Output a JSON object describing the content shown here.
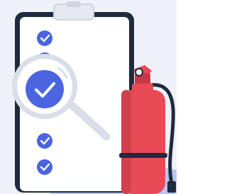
{
  "illustration": {
    "checklist_items": [
      {
        "checked": true
      },
      {
        "checked": true
      },
      {
        "checked": true
      },
      {
        "checked": true
      }
    ],
    "colors": {
      "background_tint": "#eef2f8",
      "clipboard_frame": "#1f2a3c",
      "clipboard_paper": "#ffffff",
      "check_blue": "#4b64e0",
      "magnifier_ring": "#d9dee8",
      "magnifier_lens": "#ffffff",
      "extinguisher_red": "#e84a56",
      "extinguisher_shadow": "#c8374a",
      "extinguisher_band": "#1f2a3c",
      "hill_blue": "#b9c6f2"
    }
  }
}
